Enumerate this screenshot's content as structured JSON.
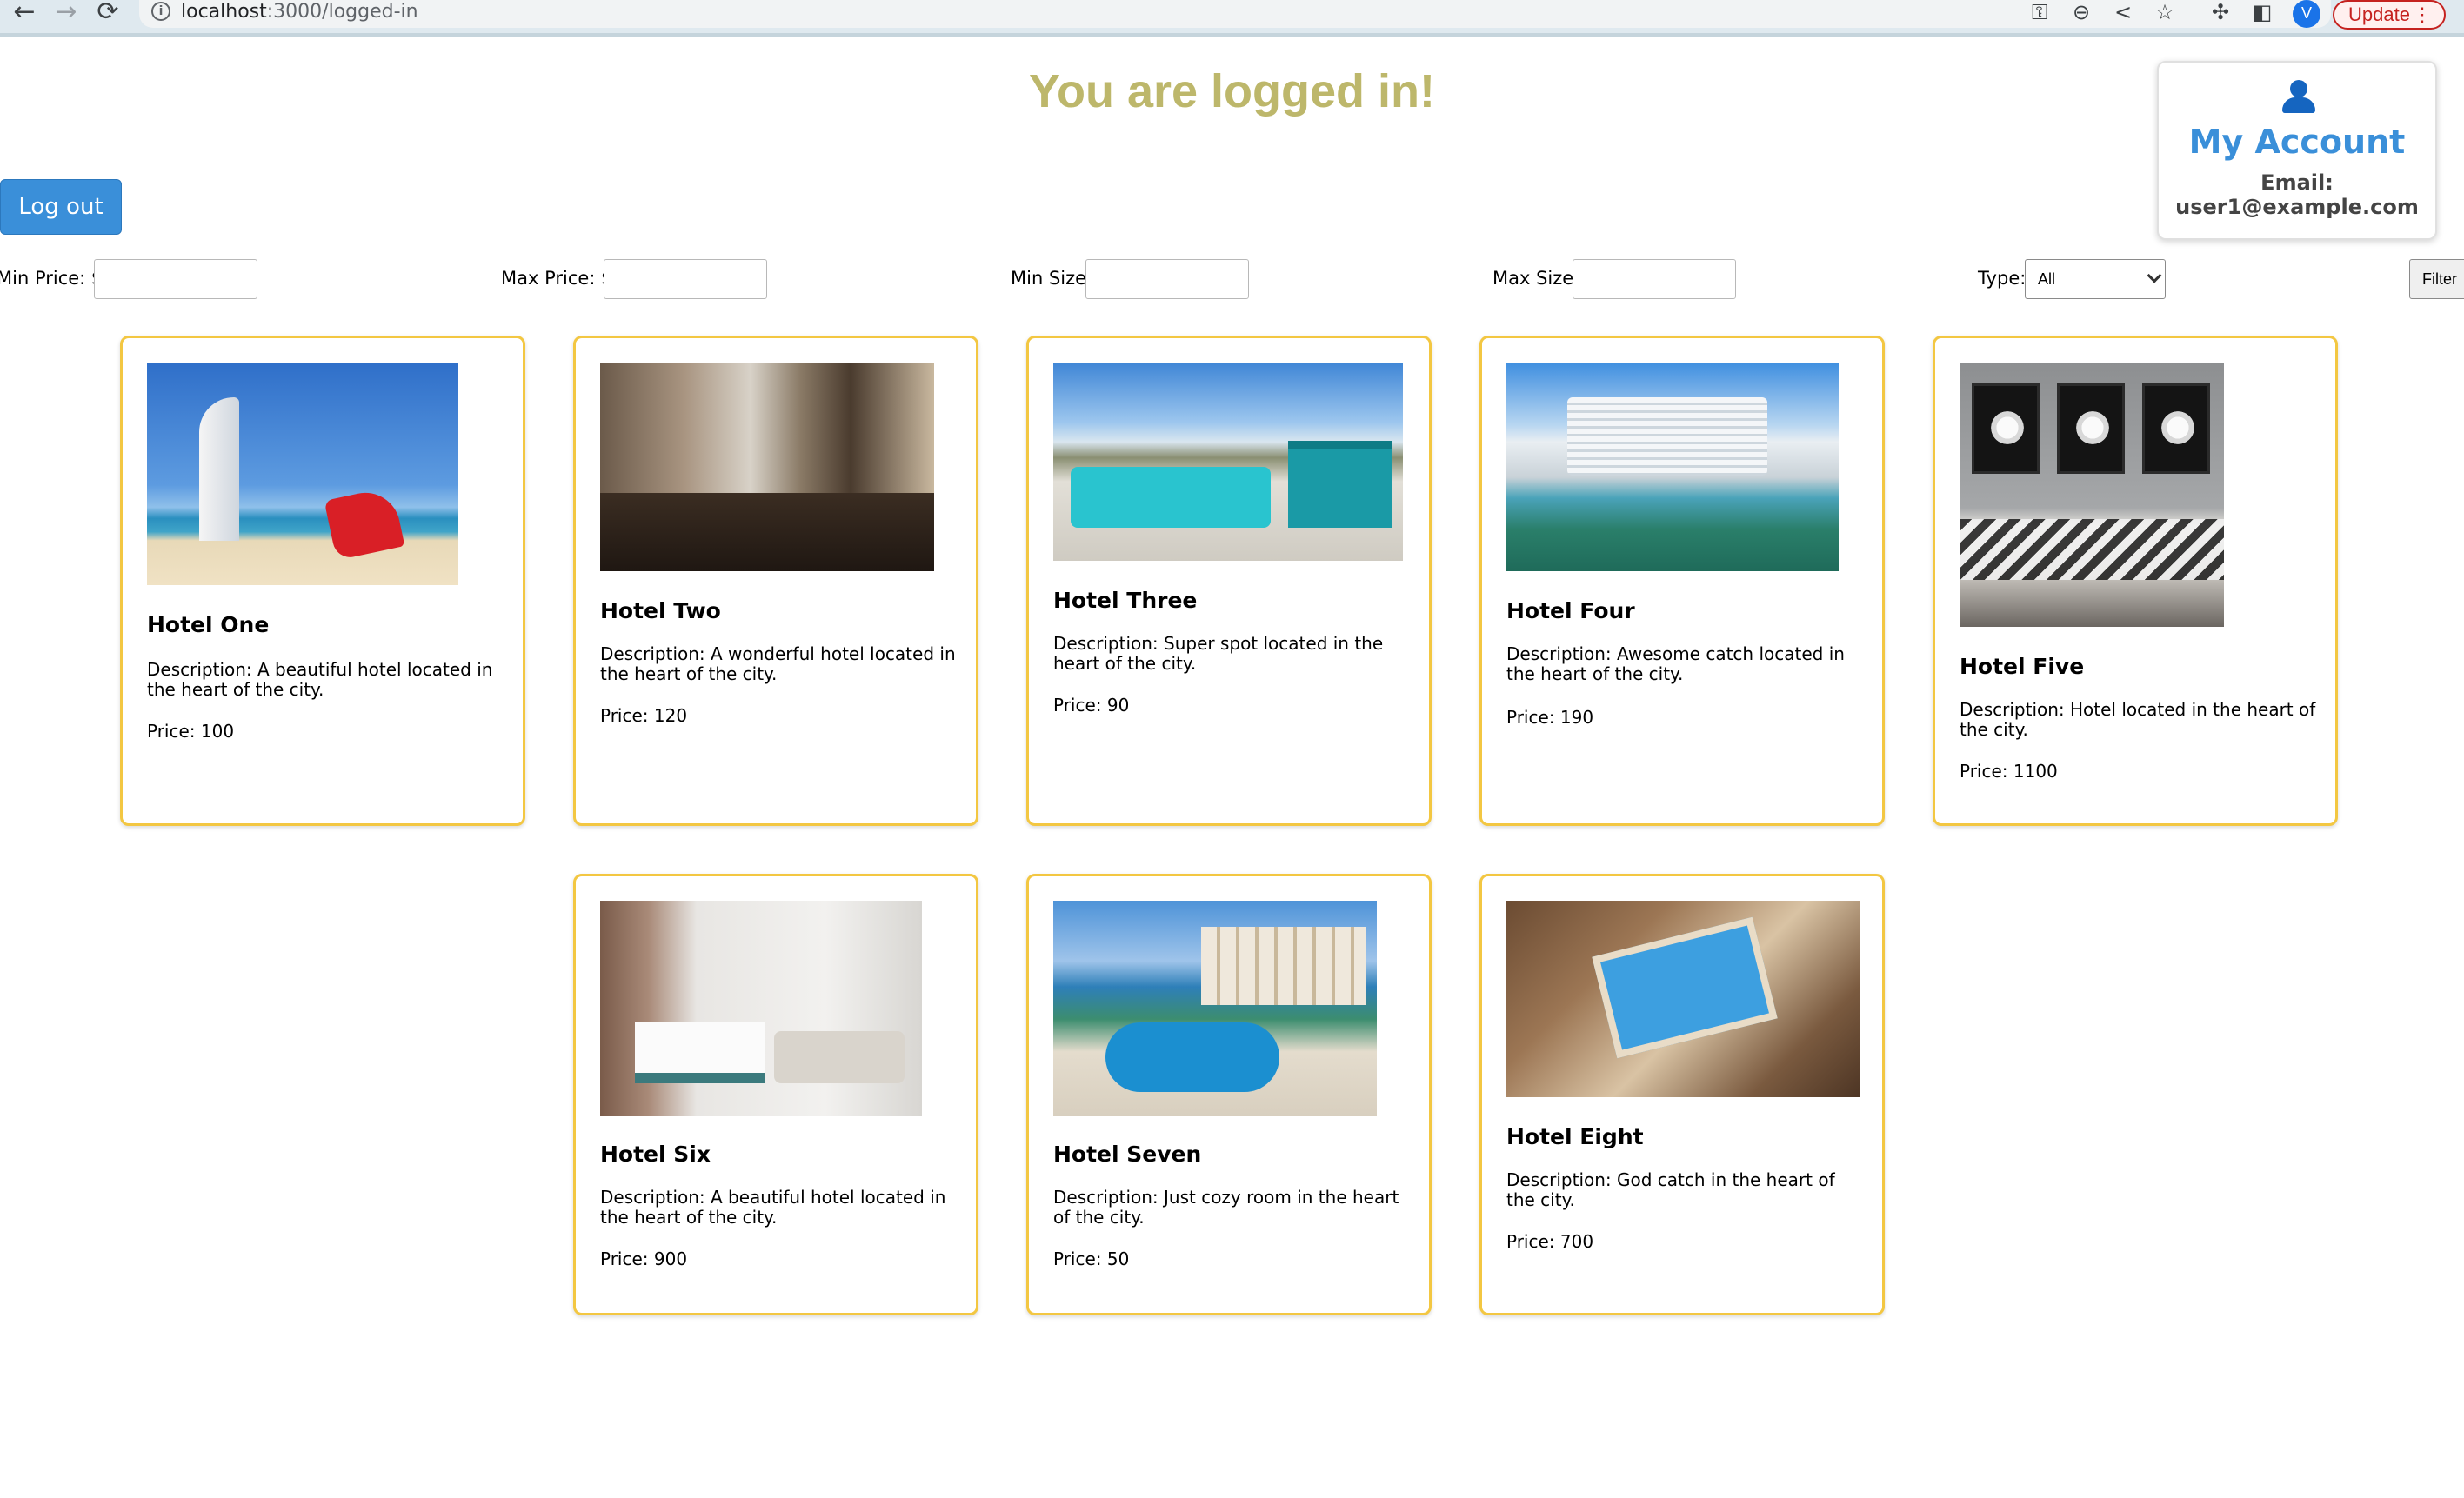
{
  "browser": {
    "url_host": "localhost",
    "url_path": ":3000/logged-in",
    "profile_initial": "V",
    "update_label": "Update",
    "update_menu": "⋮"
  },
  "page": {
    "title": "You are logged in!"
  },
  "account": {
    "title": "My Account",
    "email_label": "Email:",
    "email": "user1@example.com"
  },
  "logout_label": "Log out",
  "filters": {
    "min_price_label": "Min Price: $",
    "max_price_label": "Max Price: $",
    "min_size_label": "Min Size:",
    "max_size_label": "Max Size:",
    "type_label": "Type:",
    "type_selected": "All",
    "filter_button": "Filter",
    "min_price_value": "",
    "max_price_value": "",
    "min_size_value": "",
    "max_size_value": ""
  },
  "hotels": [
    {
      "name": "Hotel One",
      "description": "Description: A beautiful hotel located in the heart of the city.",
      "price": "Price: 100"
    },
    {
      "name": "Hotel Two",
      "description": "Description: A wonderful hotel located in the heart of the city.",
      "price": "Price: 120"
    },
    {
      "name": "Hotel Three",
      "description": "Description: Super spot located in the heart of the city.",
      "price": "Price: 90"
    },
    {
      "name": "Hotel Four",
      "description": "Description: Awesome catch located in the heart of the city.",
      "price": "Price: 190"
    },
    {
      "name": "Hotel Five",
      "description": "Description: Hotel located in the heart of the city.",
      "price": "Price: 1100"
    },
    {
      "name": "Hotel Six",
      "description": "Description: A beautiful hotel located in the heart of the city.",
      "price": "Price: 900"
    },
    {
      "name": "Hotel Seven",
      "description": "Description: Just cozy room in the heart of the city.",
      "price": "Price: 50"
    },
    {
      "name": "Hotel Eight",
      "description": "Description: God catch in the heart of the city.",
      "price": "Price: 700"
    }
  ],
  "colors": {
    "title": "#bdb76b",
    "accent_blue": "#3a8fd9",
    "card_border": "#f3c742"
  }
}
